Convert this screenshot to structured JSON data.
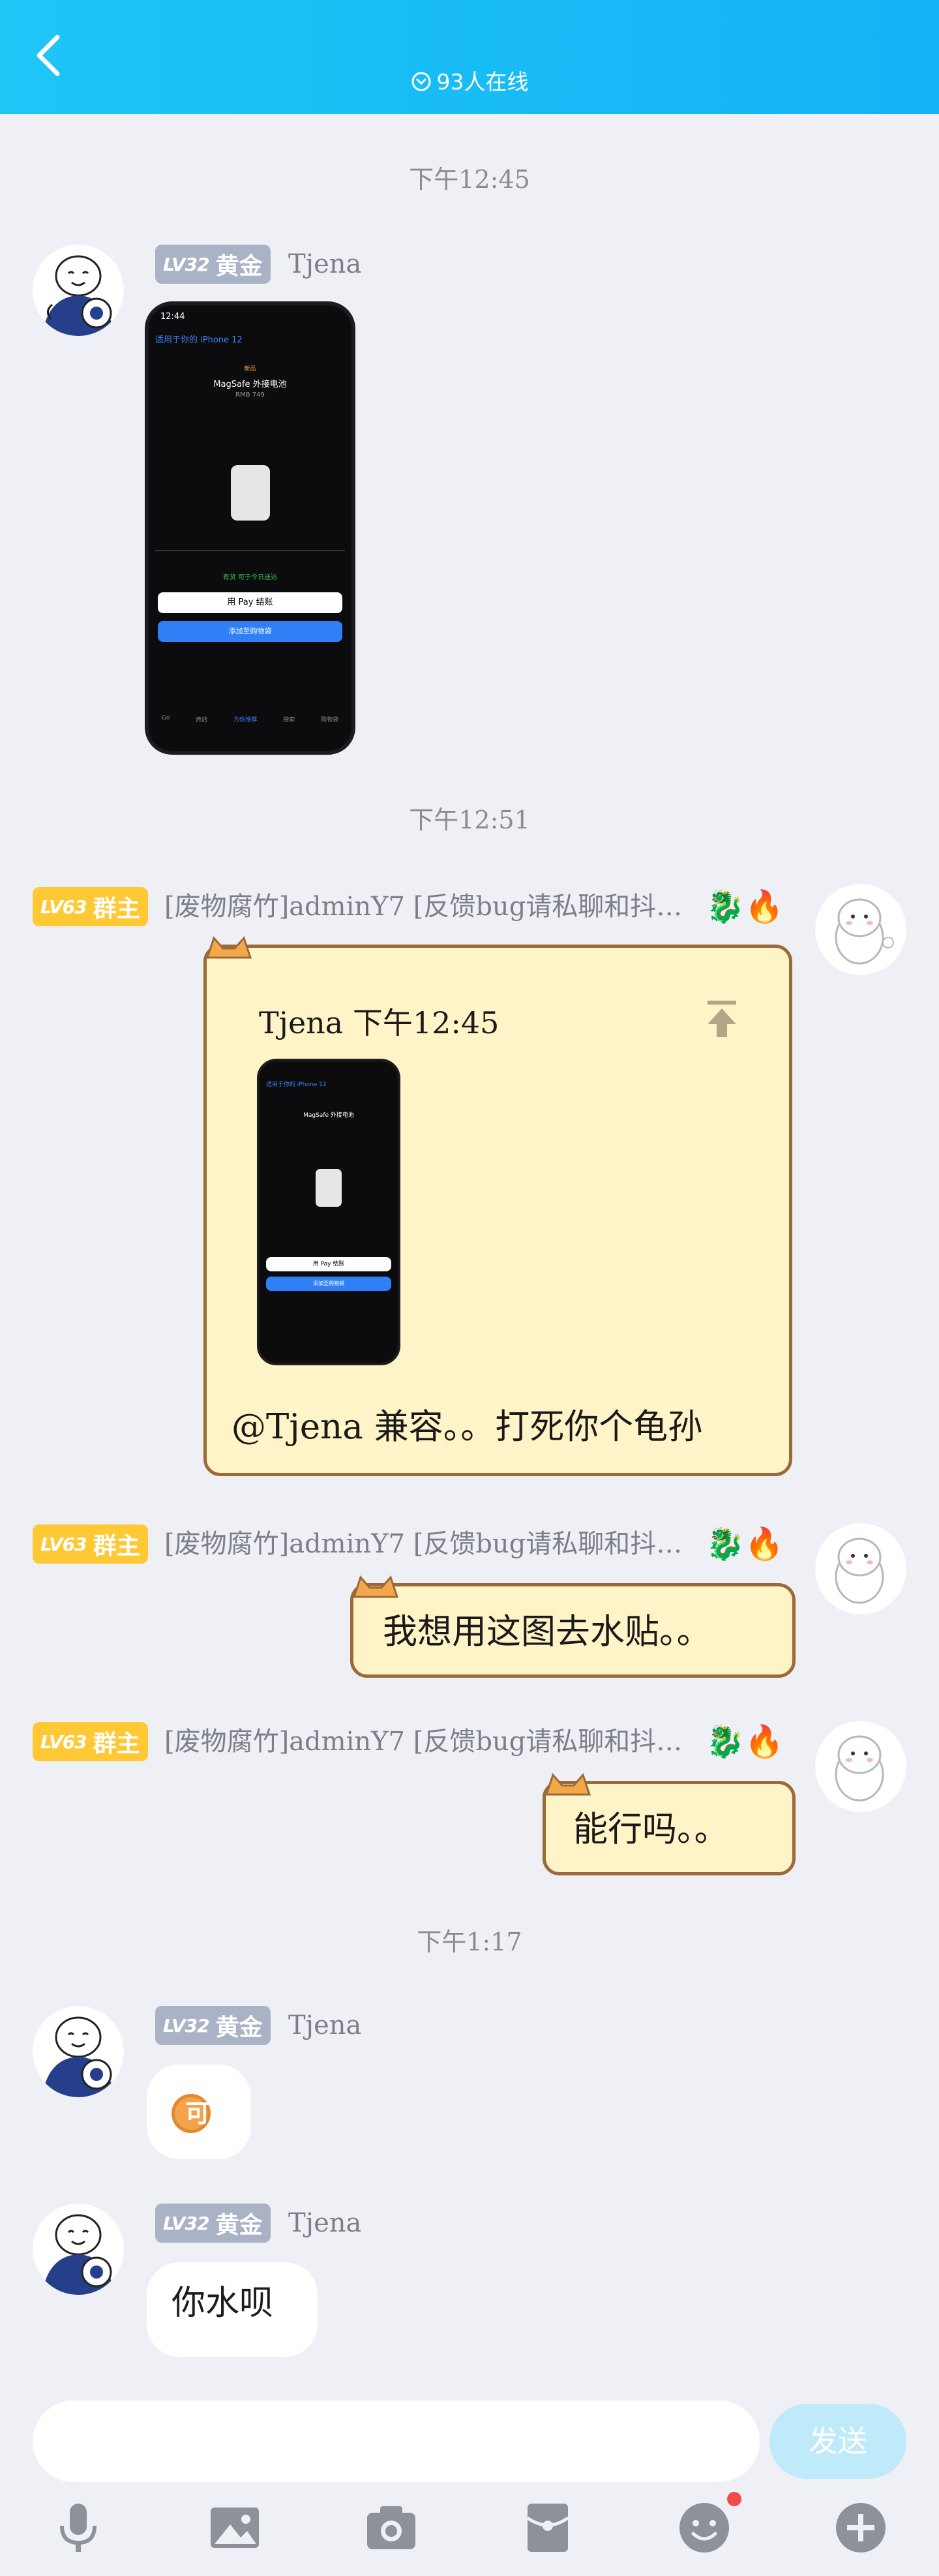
{
  "header": {
    "online_text": "93人在线",
    "background": "#16bcf5"
  },
  "times": [
    "下午12:45",
    "下午12:51",
    "下午1:17"
  ],
  "user_tjena": {
    "level": "LV32",
    "tier": "黄金",
    "name": "Tjena"
  },
  "user_admin": {
    "level": "LV63",
    "role": "群主",
    "name": "[废物腐竹]adminY7 [反馈bug请私聊和抖…"
  },
  "phone_shot": {
    "status_time": "12:44",
    "back_link": "适用于你的 iPhone 12",
    "new_tag": "新品",
    "product": "MagSafe 外接电池",
    "price": "RMB 749",
    "stock": "有货 可于今日送达",
    "apple_pay": "用  Pay 结账",
    "add_to_cart": "添加至购物袋",
    "tabs": [
      "Go",
      "商店",
      "为你推荐",
      "搜索",
      "购物袋"
    ]
  },
  "messages": {
    "quote_header": "Tjena 下午12:45",
    "quote_reply": "@Tjena 兼容。。打死你个龟孙",
    "admin_msg_2": "我想用这图去水贴。。",
    "admin_msg_3": "能行吗。。",
    "tjena_sticker": "可",
    "tjena_msg": "你水呗"
  },
  "composer": {
    "send_label": "发送",
    "input_placeholder": ""
  },
  "colors": {
    "badge_gray": "#aab2c6",
    "badge_yellow": "#ffc935",
    "cat_bubble": "#fff4c7",
    "accent": "#16bcf5"
  },
  "toolbar_icons": [
    "mic-icon",
    "image-icon",
    "camera-icon",
    "red-envelope-icon",
    "emoji-icon",
    "plus-icon"
  ]
}
